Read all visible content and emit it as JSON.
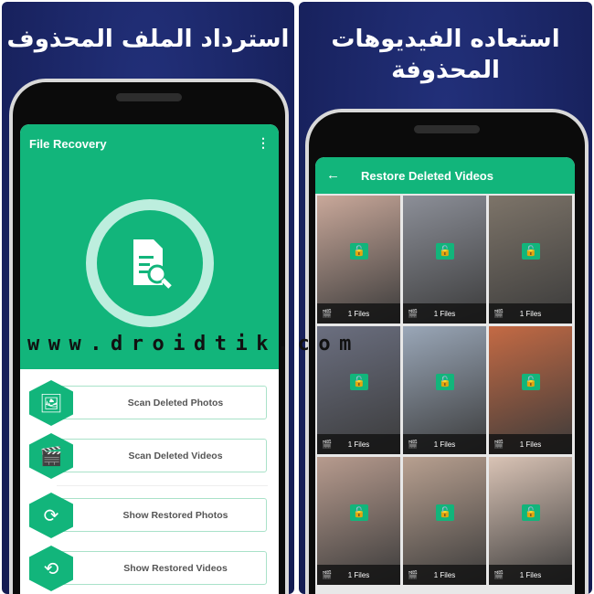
{
  "left_panel": {
    "title": "استرداد الملف المحذوف",
    "app_title": "File Recovery",
    "menu_icon": "more-vertical-icon",
    "buttons": [
      {
        "label": "Scan Deleted Photos",
        "icon": "image-icon"
      },
      {
        "label": "Scan Deleted Videos",
        "icon": "clapperboard-icon"
      },
      {
        "label": "Show Restored Photos",
        "icon": "restore-image-icon"
      },
      {
        "label": "Show Restored Videos",
        "icon": "restore-video-icon"
      }
    ]
  },
  "right_panel": {
    "title_line1": "استعاده الفيديوهات",
    "title_line2": "المحذوفة",
    "screen_title": "Restore Deleted Videos",
    "back_icon": "arrow-left-icon",
    "tiles": [
      "1 Files",
      "1 Files",
      "1 Files",
      "1 Files",
      "1 Files",
      "1 Files",
      "1 Files",
      "1 Files",
      "1 Files"
    ]
  },
  "watermark": "www.droidtik.com",
  "colors": {
    "accent": "#12b57b",
    "background": "#1b2566"
  }
}
